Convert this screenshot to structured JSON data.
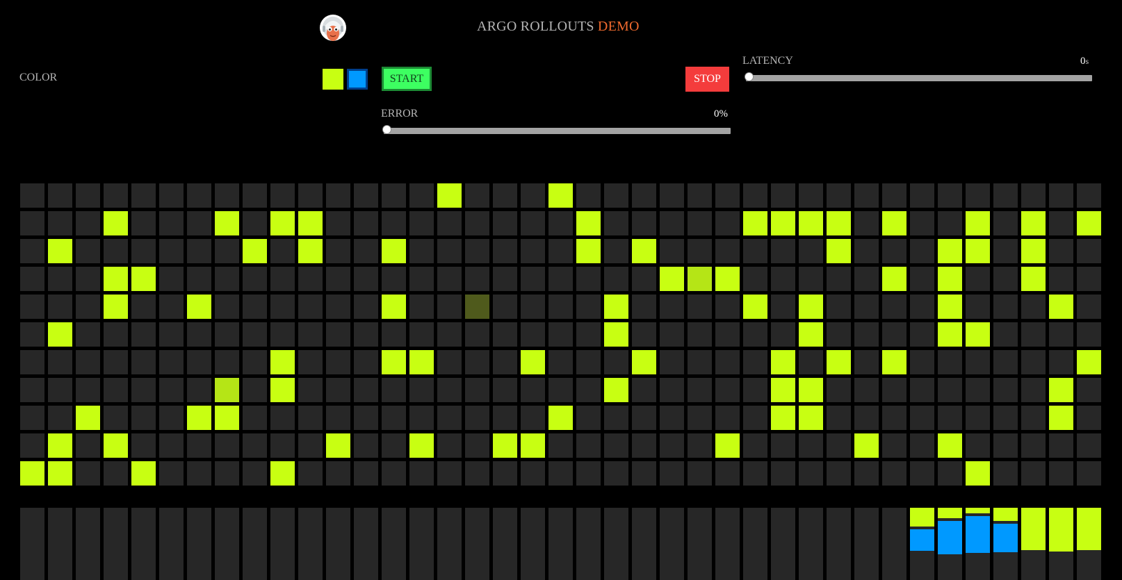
{
  "header": {
    "title": "ARGO ROLLOUTS",
    "title_accent": "DEMO",
    "logo_icon": "argo-mascot-icon"
  },
  "controls": {
    "color_label": "COLOR",
    "swatches": [
      {
        "name": "yellow",
        "color": "#c8ff12"
      },
      {
        "name": "blue",
        "color": "#0099ff",
        "selected": true
      }
    ],
    "start_label": "START",
    "stop_label": "STOP",
    "latency": {
      "label": "LATENCY",
      "value": "0",
      "unit": "s",
      "level": 0
    },
    "error": {
      "label": "ERROR",
      "value": "0%",
      "level": 0
    }
  },
  "colors": {
    "accent": "#f06a2e",
    "cell_empty": "#272727",
    "yellow": "#c8ff12",
    "yellow_faded": "#b5e516",
    "yellow_dim": "#4f5a1c",
    "blue": "#0099ff",
    "start_green": "#3dff61",
    "stop_red": "#f43c3c"
  },
  "grid": {
    "columns": 39,
    "rows": [
      [
        0,
        0,
        0,
        0,
        0,
        0,
        0,
        0,
        0,
        0,
        0,
        0,
        0,
        0,
        0,
        1,
        0,
        0,
        0,
        1,
        0,
        0,
        0,
        0,
        0,
        0,
        0,
        0,
        0,
        0,
        0,
        0,
        0,
        0,
        0,
        0,
        0,
        0,
        0
      ],
      [
        0,
        0,
        0,
        1,
        0,
        0,
        0,
        1,
        0,
        1,
        1,
        0,
        0,
        0,
        0,
        0,
        0,
        0,
        0,
        0,
        1,
        0,
        0,
        0,
        0,
        0,
        1,
        1,
        1,
        1,
        0,
        1,
        0,
        0,
        1,
        0,
        1,
        0,
        1
      ],
      [
        0,
        1,
        0,
        0,
        0,
        0,
        0,
        0,
        1,
        0,
        1,
        0,
        0,
        1,
        0,
        0,
        0,
        0,
        0,
        0,
        1,
        0,
        1,
        0,
        0,
        0,
        0,
        0,
        0,
        1,
        0,
        0,
        0,
        1,
        1,
        0,
        1,
        0,
        0
      ],
      [
        0,
        0,
        0,
        1,
        1,
        0,
        0,
        0,
        0,
        0,
        0,
        0,
        0,
        0,
        0,
        0,
        0,
        0,
        0,
        0,
        0,
        0,
        0,
        1,
        2,
        1,
        0,
        0,
        0,
        0,
        0,
        1,
        0,
        1,
        0,
        0,
        1,
        0,
        0
      ],
      [
        0,
        0,
        0,
        1,
        0,
        0,
        1,
        0,
        0,
        0,
        0,
        0,
        0,
        1,
        0,
        0,
        3,
        0,
        0,
        0,
        0,
        1,
        0,
        0,
        0,
        0,
        1,
        0,
        1,
        0,
        0,
        0,
        0,
        1,
        0,
        0,
        0,
        1,
        0
      ],
      [
        0,
        1,
        0,
        0,
        0,
        0,
        0,
        0,
        0,
        0,
        0,
        0,
        0,
        0,
        0,
        0,
        0,
        0,
        0,
        0,
        0,
        1,
        0,
        0,
        0,
        0,
        0,
        0,
        1,
        0,
        0,
        0,
        0,
        1,
        1,
        0,
        0,
        0,
        0
      ],
      [
        0,
        0,
        0,
        0,
        0,
        0,
        0,
        0,
        0,
        1,
        0,
        0,
        0,
        1,
        1,
        0,
        0,
        0,
        1,
        0,
        0,
        0,
        1,
        0,
        0,
        0,
        0,
        1,
        0,
        1,
        0,
        1,
        0,
        0,
        0,
        0,
        0,
        0,
        1
      ],
      [
        0,
        0,
        0,
        0,
        0,
        0,
        0,
        2,
        0,
        1,
        0,
        0,
        0,
        0,
        0,
        0,
        0,
        0,
        0,
        0,
        0,
        1,
        0,
        0,
        0,
        0,
        0,
        1,
        1,
        0,
        0,
        0,
        0,
        0,
        0,
        0,
        0,
        1,
        0
      ],
      [
        0,
        0,
        1,
        0,
        0,
        0,
        1,
        1,
        0,
        0,
        0,
        0,
        0,
        0,
        0,
        0,
        0,
        0,
        0,
        1,
        0,
        0,
        0,
        0,
        0,
        0,
        0,
        1,
        1,
        0,
        0,
        0,
        0,
        0,
        0,
        0,
        0,
        1,
        0
      ],
      [
        0,
        1,
        0,
        1,
        0,
        0,
        0,
        0,
        0,
        0,
        0,
        1,
        0,
        0,
        1,
        0,
        0,
        1,
        1,
        0,
        0,
        0,
        0,
        0,
        0,
        1,
        0,
        0,
        0,
        0,
        1,
        0,
        0,
        1,
        0,
        0,
        0,
        0,
        0
      ],
      [
        1,
        1,
        0,
        0,
        1,
        0,
        0,
        0,
        0,
        1,
        0,
        0,
        0,
        0,
        0,
        0,
        0,
        0,
        0,
        0,
        0,
        0,
        0,
        0,
        0,
        0,
        0,
        0,
        0,
        0,
        0,
        0,
        0,
        0,
        1,
        0,
        0,
        0,
        0
      ]
    ]
  },
  "bars": [
    {
      "index": 32,
      "yellow": 0.26,
      "blue": 0.3
    },
    {
      "index": 33,
      "yellow": 0.14,
      "blue": 0.47
    },
    {
      "index": 34,
      "yellow": 0.08,
      "blue": 0.51
    },
    {
      "index": 35,
      "yellow": 0.18,
      "blue": 0.4
    },
    {
      "index": 36,
      "yellow": 0.59,
      "blue": 0
    },
    {
      "index": 37,
      "yellow": 0.61,
      "blue": 0
    },
    {
      "index": 38,
      "yellow": 0.59,
      "blue": 0
    }
  ]
}
